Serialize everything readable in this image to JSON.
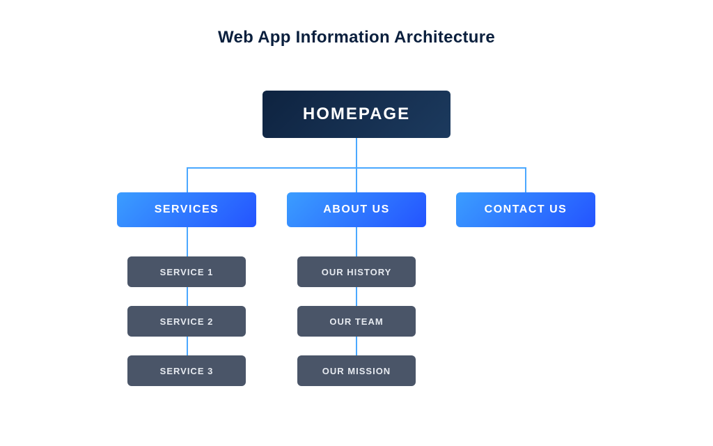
{
  "title": "Web App Information Architecture",
  "root": {
    "label": "HOMEPAGE"
  },
  "branches": [
    {
      "label": "SERVICES",
      "children": [
        {
          "label": "SERVICE 1"
        },
        {
          "label": "SERVICE 2"
        },
        {
          "label": "SERVICE 3"
        }
      ]
    },
    {
      "label": "ABOUT US",
      "children": [
        {
          "label": "OUR HISTORY"
        },
        {
          "label": "OUR TEAM"
        },
        {
          "label": "OUR MISSION"
        }
      ]
    },
    {
      "label": "CONTACT US",
      "children": []
    }
  ],
  "colors": {
    "root": [
      "#0e2340",
      "#1c3a5e"
    ],
    "branch": [
      "#3b9dff",
      "#2454ff"
    ],
    "leaf": "#4a5568",
    "connector": "#4aa8ff"
  }
}
